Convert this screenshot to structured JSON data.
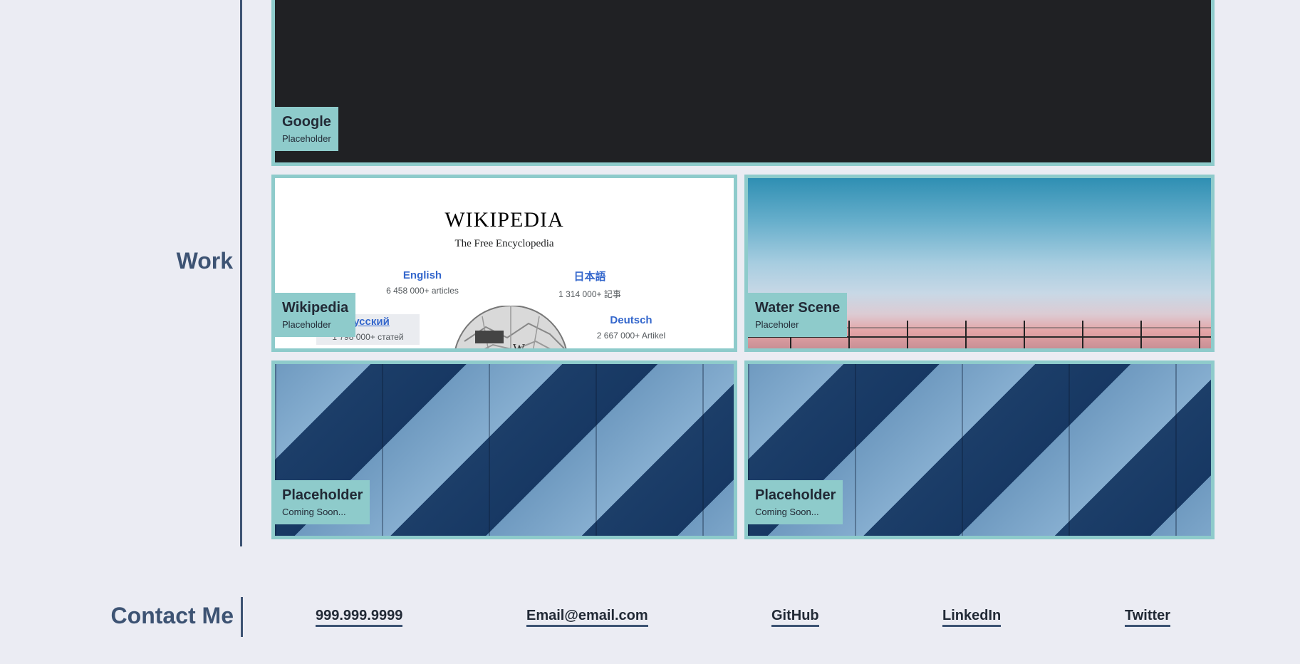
{
  "work": {
    "title": "Work",
    "tiles": [
      {
        "title": "Google",
        "subtitle": "Placeholder"
      },
      {
        "title": "Wikipedia",
        "subtitle": "Placeholder"
      },
      {
        "title": "Water Scene",
        "subtitle": "Placeholer"
      },
      {
        "title": "Placeholder",
        "subtitle": "Coming Soon..."
      },
      {
        "title": "Placeholder",
        "subtitle": "Coming Soon..."
      }
    ],
    "wikipedia_preview": {
      "logo_text": "WIKIPEDIA",
      "tagline": "The Free Encyclopedia",
      "languages": [
        {
          "name": "English",
          "count": "6 458 000+ articles"
        },
        {
          "name": "日本語",
          "count": "1 314 000+ 記事"
        },
        {
          "name": "Русский",
          "count": "1 798 000+ статей"
        },
        {
          "name": "Deutsch",
          "count": "2 667 000+ Artikel"
        }
      ]
    }
  },
  "contact": {
    "title": "Contact Me",
    "links": [
      {
        "label": "999.999.9999"
      },
      {
        "label": "Email@email.com"
      },
      {
        "label": "GitHub"
      },
      {
        "label": "LinkedIn"
      },
      {
        "label": "Twitter"
      }
    ]
  },
  "colors": {
    "background": "#ebecf3",
    "heading": "#3d5373",
    "accent": "#8ecbcb",
    "text_dark": "#222a36"
  }
}
